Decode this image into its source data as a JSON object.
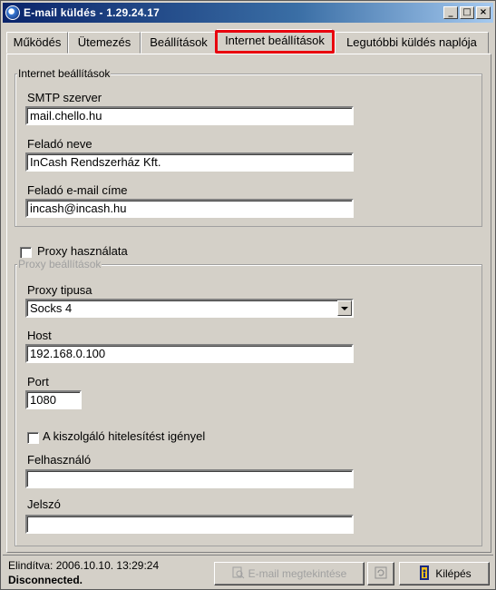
{
  "window": {
    "title": "E-mail küldés - 1.29.24.17"
  },
  "titlebar_buttons": {
    "minimize": "_",
    "maximize": "□",
    "close": "×"
  },
  "tabs": [
    {
      "label": "Működés"
    },
    {
      "label": "Ütemezés"
    },
    {
      "label": "Beállítások"
    },
    {
      "label": "Internet beállítások",
      "active": true
    },
    {
      "label": "Legutóbbi küldés naplója"
    }
  ],
  "internet": {
    "group_title": "Internet beállítások",
    "smtp_label": "SMTP szerver",
    "smtp_value": "mail.chello.hu",
    "sender_name_label": "Feladó neve",
    "sender_name_value": "InCash Rendszerház Kft.",
    "sender_email_label": "Feladó e-mail címe",
    "sender_email_value": "incash@incash.hu"
  },
  "proxy": {
    "use_label": "Proxy használata",
    "use_checked": false,
    "group_title": "Proxy beállítások",
    "type_label": "Proxy tipusa",
    "type_value": "Socks 4",
    "host_label": "Host",
    "host_value": "192.168.0.100",
    "port_label": "Port",
    "port_value": "1080",
    "auth_label": "A kiszolgáló hitelesítést igényel",
    "auth_checked": false,
    "user_label": "Felhasználó",
    "user_value": "",
    "password_label": "Jelszó",
    "password_value": ""
  },
  "status": {
    "started": "Elindítva: 2006.10.10. 13:29:24",
    "connection": "Disconnected."
  },
  "buttons": {
    "preview": "E-mail megtekintése",
    "exit": "Kilépés"
  },
  "colors": {
    "highlight": "#e8000d",
    "title_start": "#0a246a",
    "title_end": "#a6caf0"
  }
}
